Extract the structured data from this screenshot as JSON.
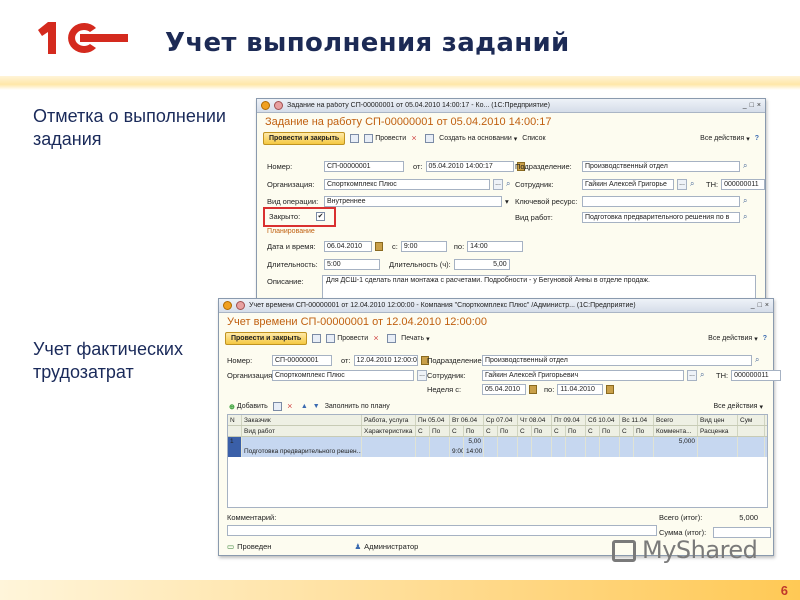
{
  "slide": {
    "title": "Учет выполнения заданий",
    "label1": "Отметка о выполнении задания",
    "label2": "Учет фактических трудозатрат",
    "page_number": "6",
    "watermark": "MyShared"
  },
  "colors": {
    "logo_red": "#d42a1e",
    "title": "#1c2a55",
    "doc_title": "#c06010",
    "highlight": "#d93030"
  },
  "win1": {
    "window_title": "Задание на работу СП-00000001 от 05.04.2010 14:00:17 - Ко...  (1С:Предприятие)",
    "doc_title": "Задание на работу СП-00000001 от 05.04.2010 14:00:17",
    "toolbar": {
      "post_close": "Провести и закрыть",
      "post": "Провести",
      "create_based": "Создать на основании",
      "list": "Список",
      "all_actions": "Все действия"
    },
    "fields": {
      "number_label": "Номер:",
      "number": "СП-00000001",
      "from_label": "от:",
      "date": "05.04.2010 14:00:17",
      "dept_label": "Подразделение:",
      "dept": "Производственный отдел",
      "org_label": "Организация:",
      "org": "Спорткомплекс Плюс",
      "employee_label": "Сотрудник:",
      "employee": "Гайкин Алексей Григорье",
      "tn_label": "ТН:",
      "tn": "000000011",
      "optype_label": "Вид операции:",
      "optype": "Внутреннее",
      "keyres_label": "Ключевой ресурс:",
      "keyres": "",
      "closed_label": "Закрыто:",
      "worktype_label": "Вид работ:",
      "worktype": "Подготовка предварительного решения по в",
      "planning": "Планирование",
      "datetime_label": "Дата и время:",
      "plan_date": "06.04.2010",
      "from2_label": "с:",
      "time_from": "9:00",
      "to_label": "по:",
      "time_to": "14:00",
      "duration_label": "Длительность:",
      "duration": "5:00",
      "duration_h_label": "Длительность (ч):",
      "duration_h": "5,00",
      "desc_label": "Описание:",
      "desc": "Для ДСШ-1 сделать план монтажа с расчетами. Подробности - у Бегуновой Анны в отделе продаж."
    }
  },
  "win2": {
    "window_title": "Учет времени СП-00000001 от 12.04.2010 12:00:00 - Компания \"Спорткомплекс Плюс\" /Администр...  (1С:Предприятие)",
    "doc_title": "Учет времени СП-00000001 от 12.04.2010 12:00:00",
    "toolbar": {
      "post_close": "Провести и закрыть",
      "post": "Провести",
      "print": "Печать",
      "all_actions": "Все действия"
    },
    "fields": {
      "number_label": "Номер:",
      "number": "СП-00000001",
      "from_label": "от:",
      "date": "12.04.2010 12:00:00",
      "dept_label": "Подразделение:",
      "dept": "Производственный отдел",
      "org_label": "Организация:",
      "org": "Спорткомплекс Плюс",
      "employee_label": "Сотрудник:",
      "employee": "Гайкин Алексей Григорьевич",
      "tn_label": "ТН:",
      "tn": "000000011",
      "week_label": "Неделя с:",
      "week_from": "05.04.2010",
      "week_to_label": "по:",
      "week_to": "11.04.2010"
    },
    "table_toolbar": {
      "add": "Добавить",
      "fill": "Заполнить по плану",
      "all_actions": "Все действия"
    },
    "table": {
      "header1": [
        "N",
        "Заказчик",
        "Работа, услуга",
        "Пн 05.04",
        "Вт 06.04",
        "Ср 07.04",
        "Чт 08.04",
        "Пт 09.04",
        "Сб 10.04",
        "Вс 11.04",
        "Всего",
        "Вид цен",
        "Сум"
      ],
      "header2": [
        "",
        "Вид работ",
        "Характеристика",
        "С",
        "По",
        "С",
        "По",
        "С",
        "По",
        "С",
        "По",
        "С",
        "По",
        "С",
        "По",
        "С",
        "По",
        "Коммента...",
        "Расценка",
        ""
      ],
      "row1": [
        "1",
        "",
        "",
        "",
        "",
        "",
        "5,00",
        "",
        "",
        "",
        "",
        "",
        "",
        "",
        "",
        "",
        "",
        "5,000",
        "",
        ""
      ],
      "row2": [
        "",
        "Подготовка предварительного решен...",
        "",
        "",
        "",
        "9:00",
        "14:00",
        "",
        "",
        "",
        "",
        "",
        "",
        "",
        "",
        "",
        "",
        "",
        "",
        ""
      ]
    },
    "footer": {
      "comment_label": "Комментарий:",
      "total_label": "Всего (итог):",
      "total": "5,000",
      "sum_label": "Сумма (итог):",
      "sum": "",
      "status": "Проведен",
      "user": "Администратор"
    }
  }
}
